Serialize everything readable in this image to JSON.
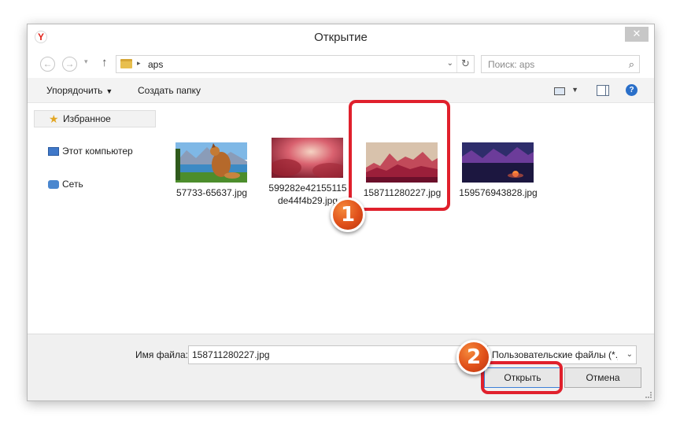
{
  "window": {
    "title": "Открытие",
    "app_icon": "Y",
    "close_glyph": "✕"
  },
  "nav": {
    "back_glyph": "←",
    "forward_glyph": "→",
    "recent_glyph": "▾",
    "up_glyph": "↑"
  },
  "address": {
    "arrow": "▸",
    "folder": "aps",
    "dropdown_glyph": "⌄",
    "refresh_glyph": "↻"
  },
  "search": {
    "placeholder": "Поиск: aps",
    "icon_glyph": "⌕"
  },
  "toolbar": {
    "organize_label": "Упорядочить",
    "organize_caret": "▼",
    "new_folder_label": "Создать папку",
    "view_caret": "▼",
    "help_glyph": "?"
  },
  "sidebar": {
    "items": [
      {
        "label": "Избранное",
        "icon": "star-icon",
        "glyph": "★",
        "selected": true
      },
      {
        "label": "Этот компьютер",
        "icon": "computer-icon",
        "selected": false
      },
      {
        "label": "Сеть",
        "icon": "network-icon",
        "selected": false
      }
    ]
  },
  "files": [
    {
      "name": "57733-65637.jpg"
    },
    {
      "name": "599282e42155115de44f4b29.jpg",
      "name_line1": "599282e42155115",
      "name_line2": "de44f4b29.jpg"
    },
    {
      "name": "158711280227.jpg"
    },
    {
      "name": "159576943828.jpg"
    }
  ],
  "footer": {
    "filename_label": "Имя файла:",
    "filename_value": "158711280227.jpg",
    "filetype_value": "Пользовательские файлы (*.jf",
    "filetype_arrow": "⌄",
    "open_label": "Открыть",
    "cancel_label": "Отмена"
  },
  "annotations": {
    "badge_1": "1",
    "badge_2": "2",
    "highlight_color": "#e0202c",
    "badge_color": "#e0501a"
  }
}
